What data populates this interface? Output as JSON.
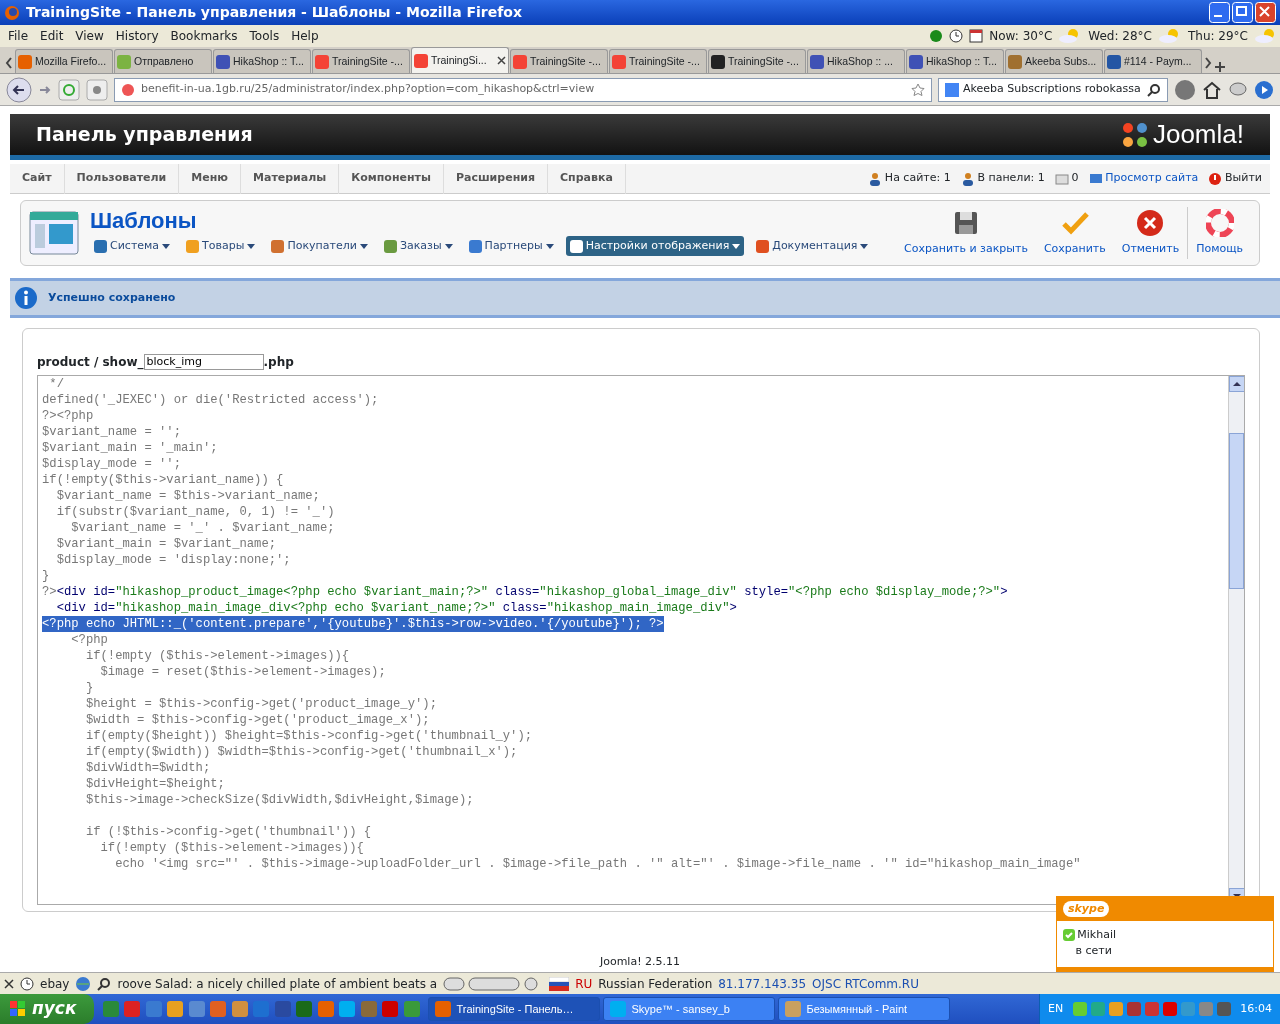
{
  "window": {
    "title": "TrainingSite - Панель управления - Шаблоны - Mozilla Firefox"
  },
  "menu_bar": [
    "File",
    "Edit",
    "View",
    "History",
    "Bookmarks",
    "Tools",
    "Help"
  ],
  "weather": [
    {
      "label": "Now: 30°C"
    },
    {
      "label": "Wed: 28°C"
    },
    {
      "label": "Thu: 29°C"
    }
  ],
  "tabs": [
    {
      "label": "Mozilla Firefo...",
      "selected": false,
      "color": "#e66000"
    },
    {
      "label": "Отправлено",
      "selected": false,
      "color": "#7cb342"
    },
    {
      "label": "HikaShop :: T...",
      "selected": false,
      "color": "#3f51b5"
    },
    {
      "label": "TrainingSite -...",
      "selected": false,
      "color": "#f44336"
    },
    {
      "label": "TrainingSi...",
      "selected": true,
      "color": "#f44336"
    },
    {
      "label": "TrainingSite -...",
      "selected": false,
      "color": "#f44336"
    },
    {
      "label": "TrainingSite -...",
      "selected": false,
      "color": "#f44336"
    },
    {
      "label": "TrainingSite -...",
      "selected": false,
      "color": "#222222"
    },
    {
      "label": "HikaShop :: ...",
      "selected": false,
      "color": "#3f51b5"
    },
    {
      "label": "HikaShop :: T...",
      "selected": false,
      "color": "#3f51b5"
    },
    {
      "label": "Akeeba Subs...",
      "selected": false,
      "color": "#a07030"
    },
    {
      "label": "#114 - Paym...",
      "selected": false,
      "color": "#2456a4"
    }
  ],
  "address_bar": {
    "value": "benefit-in-ua.1gb.ru/25/administrator/index.php?option=com_hikashop&ctrl=view"
  },
  "search_bar": {
    "value": "Akeeba Subscriptions robokassa"
  },
  "header": {
    "title": "Панель управления",
    "logo": "Joomla!"
  },
  "admin_menu": [
    "Сайт",
    "Пользователи",
    "Меню",
    "Материалы",
    "Компоненты",
    "Расширения",
    "Справка"
  ],
  "status": {
    "on_site": "На сайте: 1",
    "in_panel": "В панели: 1",
    "messages": "0",
    "view_site": "Просмотр сайта",
    "logout": "Выйти"
  },
  "page": {
    "title": "Шаблоны"
  },
  "submenu": [
    {
      "label": "Система",
      "selected": false
    },
    {
      "label": "Товары",
      "selected": false
    },
    {
      "label": "Покупатели",
      "selected": false
    },
    {
      "label": "Заказы",
      "selected": false
    },
    {
      "label": "Партнеры",
      "selected": false
    },
    {
      "label": "Настройки отображения",
      "selected": true
    },
    {
      "label": "Документация",
      "selected": false
    }
  ],
  "toolbar": [
    {
      "label": "Сохранить и закрыть",
      "kind": "save"
    },
    {
      "label": "Сохранить",
      "kind": "apply"
    },
    {
      "label": "Отменить",
      "kind": "cancel"
    },
    {
      "label": "Помощь",
      "kind": "help"
    }
  ],
  "message": "Успешно сохранено",
  "editor": {
    "prefix": "product / show_",
    "file_name": "block_img",
    "suffix": ".php",
    "lines": [
      {
        "kind": "php",
        "selected": false,
        "text": " */"
      },
      {
        "kind": "php",
        "selected": false,
        "text": "defined('_JEXEC') or die('Restricted access');"
      },
      {
        "kind": "php",
        "selected": false,
        "text": "?><?php"
      },
      {
        "kind": "php",
        "selected": false,
        "text": "$variant_name = '';"
      },
      {
        "kind": "php",
        "selected": false,
        "text": "$variant_main = '_main';"
      },
      {
        "kind": "php",
        "selected": false,
        "text": "$display_mode = '';"
      },
      {
        "kind": "php",
        "selected": false,
        "text": "if(!empty($this->variant_name)) {"
      },
      {
        "kind": "php",
        "selected": false,
        "text": "  $variant_name = $this->variant_name;"
      },
      {
        "kind": "php",
        "selected": false,
        "text": "  if(substr($variant_name, 0, 1) != '_')"
      },
      {
        "kind": "php",
        "selected": false,
        "text": "    $variant_name = '_' . $variant_name;"
      },
      {
        "kind": "php",
        "selected": false,
        "text": "  $variant_main = $variant_name;"
      },
      {
        "kind": "php",
        "selected": false,
        "text": "  $display_mode = 'display:none;';"
      },
      {
        "kind": "php",
        "selected": false,
        "text": "}"
      },
      {
        "kind": "html",
        "selected": false,
        "segments": [
          {
            "t": "?>",
            "kind": "php"
          },
          {
            "t": "<div id=",
            "kind": "tag"
          },
          {
            "t": "\"hikashop_product_image<?php echo $variant_main;?>\"",
            "kind": "str"
          },
          {
            "t": " class=",
            "kind": "tag"
          },
          {
            "t": "\"hikashop_global_image_div\"",
            "kind": "str"
          },
          {
            "t": " style=",
            "kind": "tag"
          },
          {
            "t": "\"<?php echo $display_mode;?>\"",
            "kind": "str"
          },
          {
            "t": ">",
            "kind": "tag"
          }
        ]
      },
      {
        "kind": "html",
        "selected": false,
        "segments": [
          {
            "t": "  <div id=",
            "kind": "tag"
          },
          {
            "t": "\"hikashop_main_image_div<?php echo $variant_name;?>\"",
            "kind": "str"
          },
          {
            "t": " class=",
            "kind": "tag"
          },
          {
            "t": "\"hikashop_main_image_div\"",
            "kind": "str"
          },
          {
            "t": ">",
            "kind": "tag"
          }
        ]
      },
      {
        "kind": "php",
        "selected": true,
        "text": "<?php echo JHTML::_('content.prepare','{youtube}'.$this->row->video.'{/youtube}'); ?>"
      },
      {
        "kind": "php",
        "selected": false,
        "text": "    <?php"
      },
      {
        "kind": "php",
        "selected": false,
        "text": "      if(!empty ($this->element->images)){"
      },
      {
        "kind": "php",
        "selected": false,
        "text": "        $image = reset($this->element->images);"
      },
      {
        "kind": "php",
        "selected": false,
        "text": "      }"
      },
      {
        "kind": "php",
        "selected": false,
        "text": "      $height = $this->config->get('product_image_y');"
      },
      {
        "kind": "php",
        "selected": false,
        "text": "      $width = $this->config->get('product_image_x');"
      },
      {
        "kind": "php",
        "selected": false,
        "text": "      if(empty($height)) $height=$this->config->get('thumbnail_y');"
      },
      {
        "kind": "php",
        "selected": false,
        "text": "      if(empty($width)) $width=$this->config->get('thumbnail_x');"
      },
      {
        "kind": "php",
        "selected": false,
        "text": "      $divWidth=$width;"
      },
      {
        "kind": "php",
        "selected": false,
        "text": "      $divHeight=$height;"
      },
      {
        "kind": "php",
        "selected": false,
        "text": "      $this->image->checkSize($divWidth,$divHeight,$image);"
      },
      {
        "kind": "blank",
        "selected": false
      },
      {
        "kind": "php",
        "selected": false,
        "text": "      if (!$this->config->get('thumbnail')) {"
      },
      {
        "kind": "php",
        "selected": false,
        "text": "        if(!empty ($this->element->images)){"
      },
      {
        "kind": "php",
        "selected": false,
        "text": "          echo '<img src=\"' . $this->image->uploadFolder_url . $image->file_path . '\" alt=\"' . $image->file_name . '\" id=\"hikashop_main_image\""
      }
    ]
  },
  "footer": "Joomla! 2.5.11",
  "addon_bar": {
    "ebay": "ebay",
    "radio": "roove Salad: a nicely chilled plate of ambient beats a",
    "country_code": "RU",
    "country": "Russian Federation",
    "ip": "81.177.143.35",
    "isp": "OJSC RTComm.RU"
  },
  "skype_popup": {
    "logo": "skype",
    "contact": "Mikhail",
    "status": "в сети"
  },
  "taskbar": {
    "start": "пуск",
    "tasks": [
      {
        "label": "TrainingSite - Панель…",
        "selected": true
      },
      {
        "label": "Skype™ - sansey_b",
        "selected": false
      },
      {
        "label": "Безымянный - Paint",
        "selected": false
      }
    ],
    "language": "EN",
    "clock": "16:04"
  }
}
